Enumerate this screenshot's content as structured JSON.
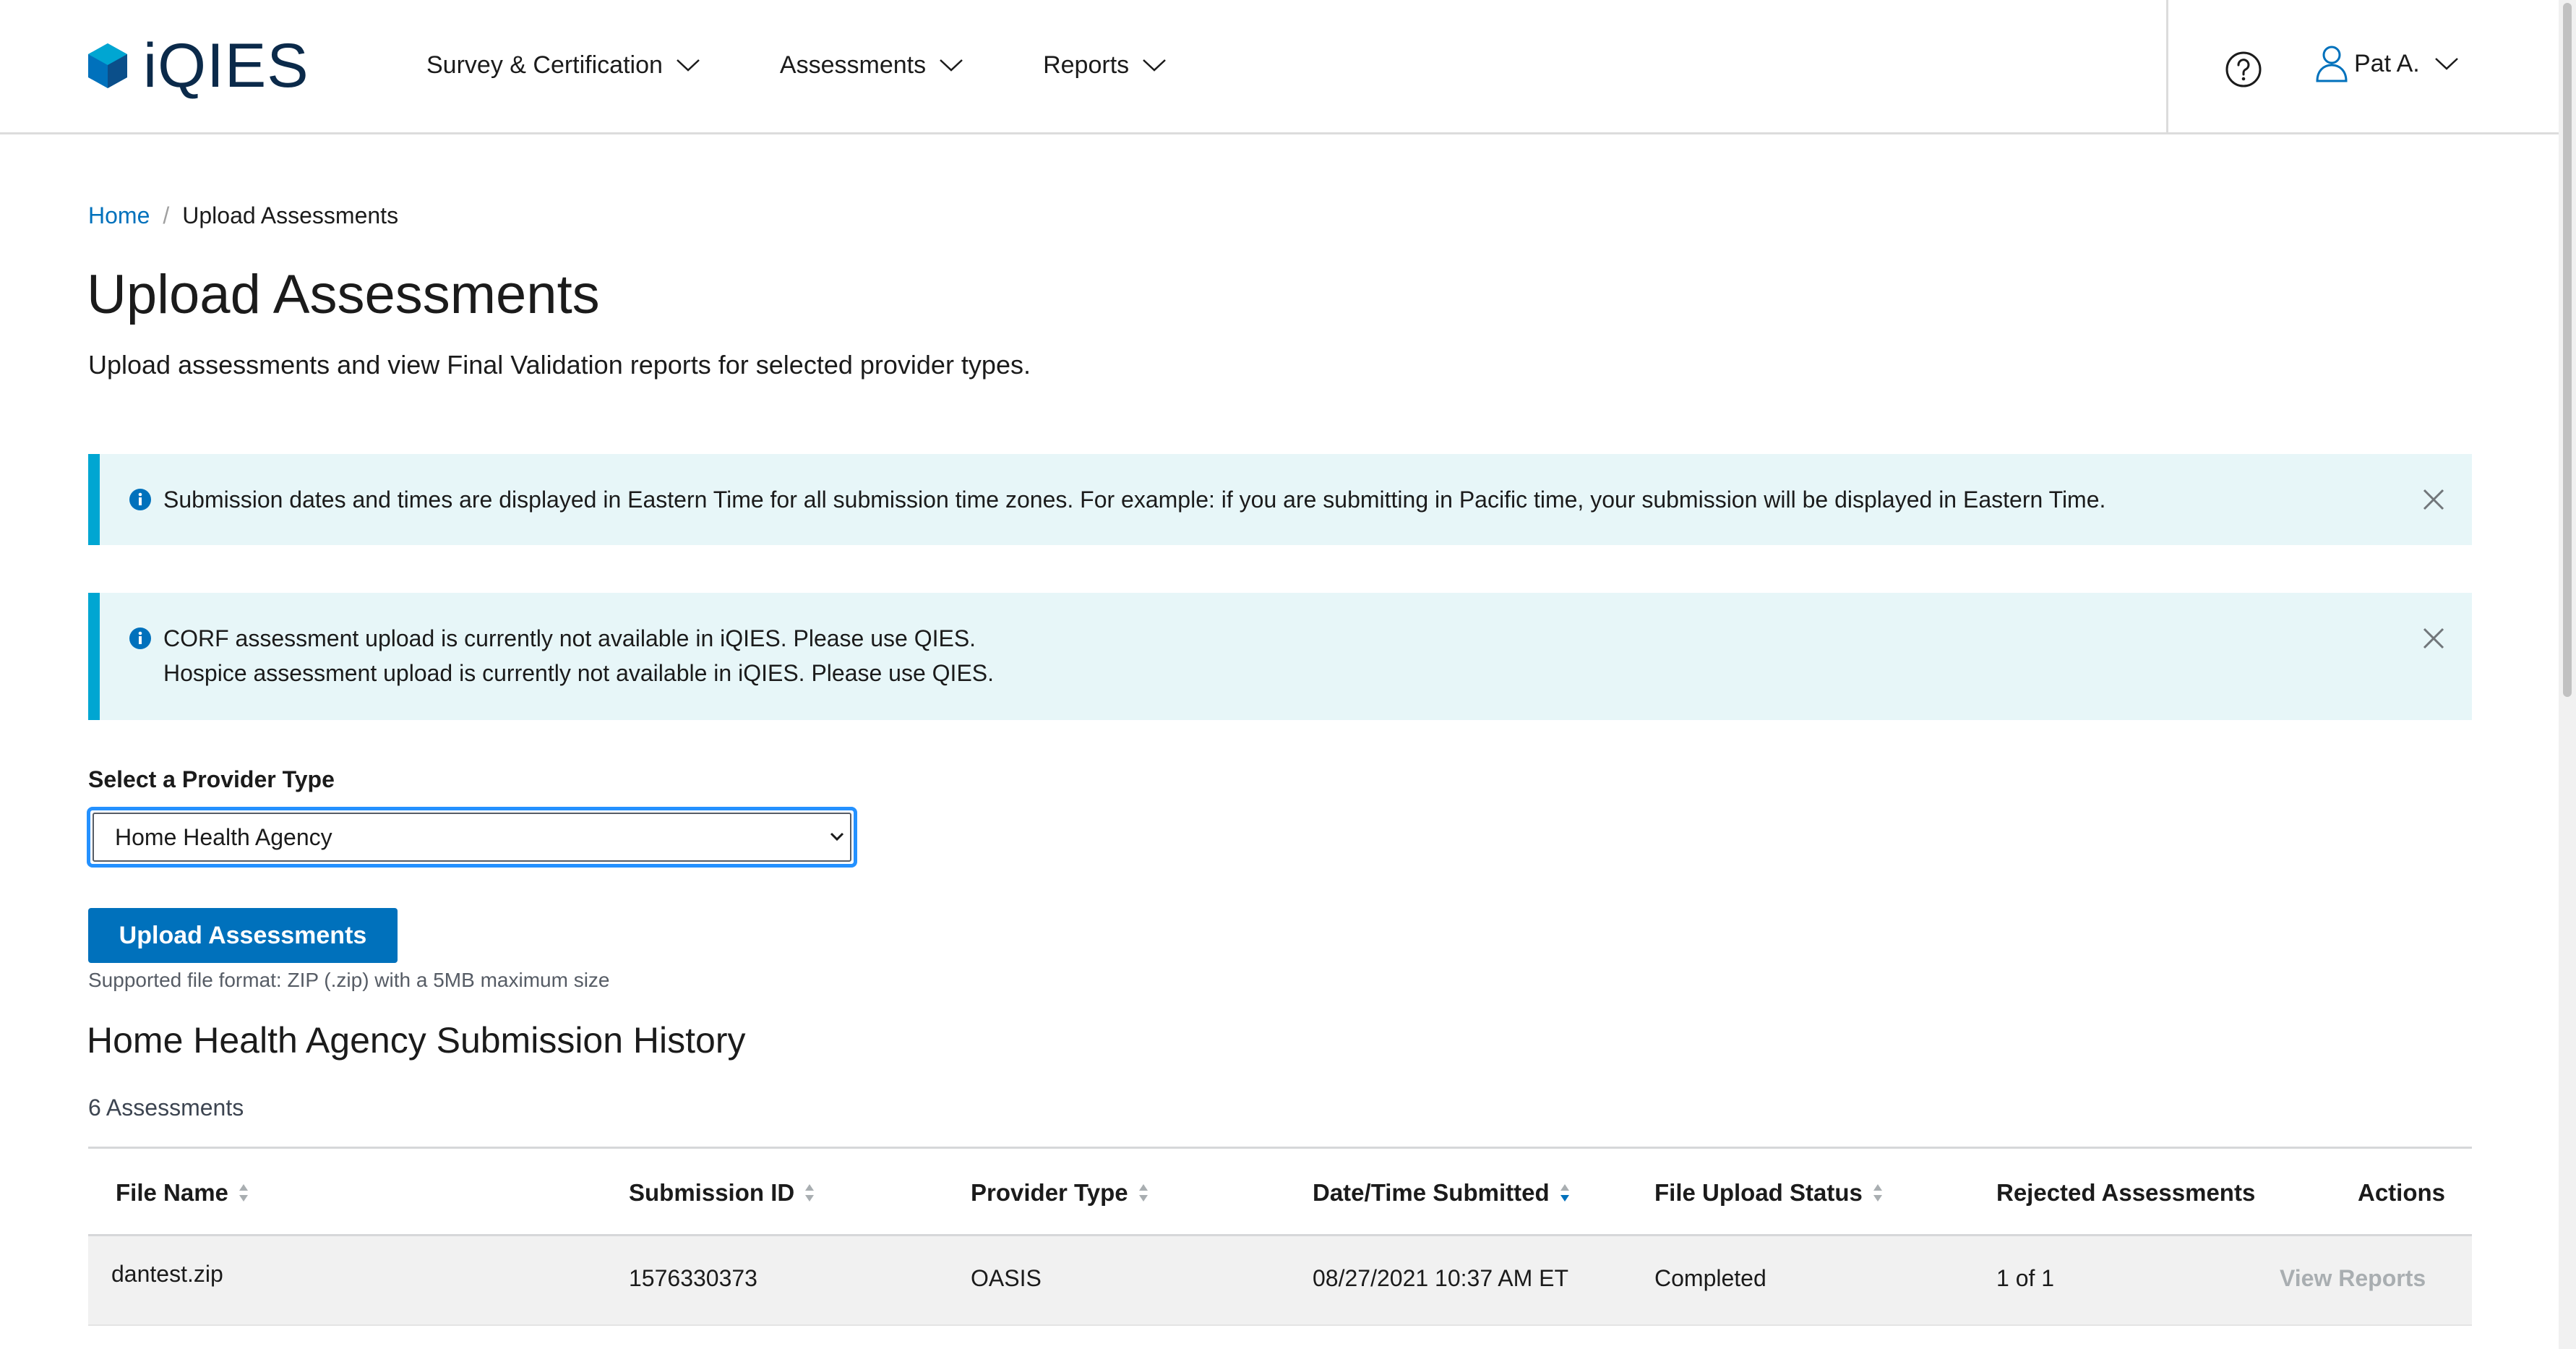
{
  "brand": {
    "name": "iQIES",
    "color": "#0071bc"
  },
  "nav": {
    "items": [
      {
        "label": "Survey & Certification"
      },
      {
        "label": "Assessments"
      },
      {
        "label": "Reports"
      }
    ],
    "help_icon": "question-circle-icon",
    "user": {
      "name": "Pat A.",
      "icon": "user-icon"
    }
  },
  "breadcrumb": {
    "home": "Home",
    "current": "Upload Assessments"
  },
  "page": {
    "title": "Upload Assessments",
    "subtitle": "Upload assessments and view Final Validation reports for selected provider types."
  },
  "alerts": [
    {
      "icon": "info-icon",
      "text": "Submission dates and times are displayed in Eastern Time for all submission time zones. For example: if you are submitting in Pacific time, your submission will be displayed in Eastern Time."
    },
    {
      "icon": "info-icon",
      "lines": [
        "CORF assessment upload is currently not available in iQIES. Please use QIES.",
        "Hospice assessment upload is currently not available in iQIES. Please use QIES."
      ]
    }
  ],
  "provider_select": {
    "label": "Select a Provider Type",
    "value": "Home Health Agency"
  },
  "upload": {
    "button_label": "Upload Assessments",
    "hint": "Supported file format: ZIP (.zip) with a 5MB maximum size"
  },
  "history": {
    "title": "Home Health Agency Submission History",
    "count": "6 Assessments",
    "columns": [
      "File Name",
      "Submission ID",
      "Provider Type",
      "Date/Time Submitted",
      "File Upload Status",
      "Rejected Assessments",
      "Actions"
    ],
    "rows": [
      {
        "file_name": "dantest.zip",
        "submission_id": "1576330373",
        "provider_type": "OASIS",
        "submitted": "08/27/2021 10:37 AM ET",
        "status": "Completed",
        "rejected": "1 of 1",
        "action": "View Reports"
      }
    ]
  },
  "colors": {
    "accent": "#0071bc",
    "alert_bg": "#e7f6f8",
    "alert_border": "#00a6d2",
    "focus": "#2491ff"
  }
}
